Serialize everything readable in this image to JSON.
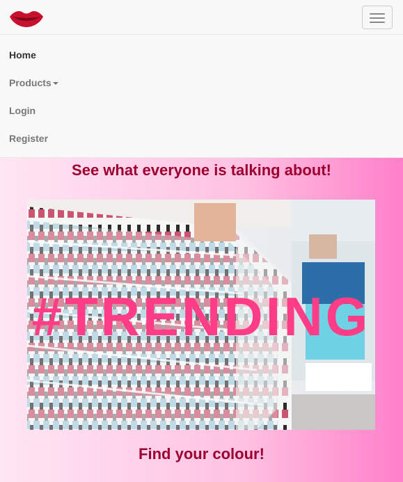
{
  "nav": {
    "logo_icon": "lips-icon",
    "toggle_icon": "hamburger-icon",
    "items": [
      {
        "label": "Home"
      },
      {
        "label": "Products"
      },
      {
        "label": "Login"
      },
      {
        "label": "Register"
      }
    ]
  },
  "main": {
    "heading": "See what everyone is talking about!",
    "image_overlay": "#TRENDING",
    "subheading": "Find your colour!"
  },
  "colors": {
    "accent": "#9c0030",
    "overlay_text": "#ff3d86",
    "gradient_end": "#ff7fcb"
  }
}
